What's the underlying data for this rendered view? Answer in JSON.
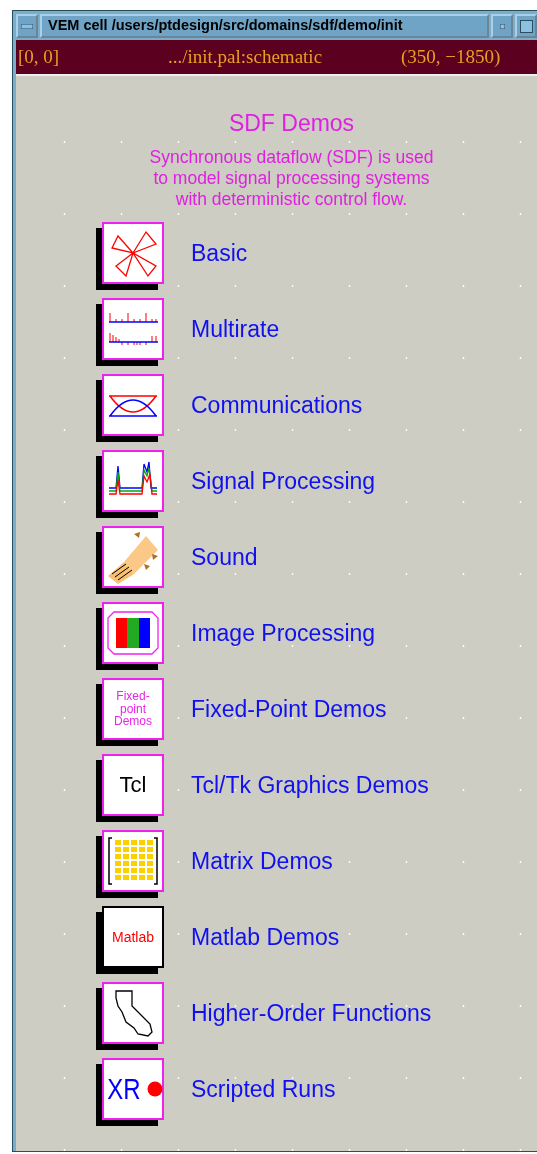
{
  "window": {
    "title": "VEM cell /users/ptdesign/src/domains/sdf/demo/init"
  },
  "status_bar": {
    "cell": "[0, 0]",
    "path": ".../init.pal:schematic",
    "coords": "(350, −1850)"
  },
  "heading": "SDF Demos",
  "description": [
    "Synchronous dataflow (SDF) is used",
    "to model signal processing systems",
    "with deterministic control flow."
  ],
  "demos": [
    {
      "label": "Basic",
      "kind": "petals"
    },
    {
      "label": "Multirate",
      "kind": "stems"
    },
    {
      "label": "Communications",
      "kind": "eye"
    },
    {
      "label": "Signal Processing",
      "kind": "spectrum"
    },
    {
      "label": "Sound",
      "kind": "speaker"
    },
    {
      "label": "Image Processing",
      "kind": "rgb"
    },
    {
      "label": "Fixed-Point Demos",
      "kind": "text",
      "icon_lines": [
        "Fixed-",
        "point",
        "Demos"
      ]
    },
    {
      "label": "Tcl/Tk Graphics Demos",
      "kind": "text",
      "icon_lines": [
        "Tcl"
      ]
    },
    {
      "label": "Matrix Demos",
      "kind": "matrix"
    },
    {
      "label": "Matlab Demos",
      "kind": "text",
      "icon_lines": [
        "Matlab"
      ]
    },
    {
      "label": "Higher-Order Functions",
      "kind": "map"
    },
    {
      "label": "Scripted Runs",
      "kind": "xr",
      "icon_lines": [
        "XR"
      ]
    }
  ]
}
